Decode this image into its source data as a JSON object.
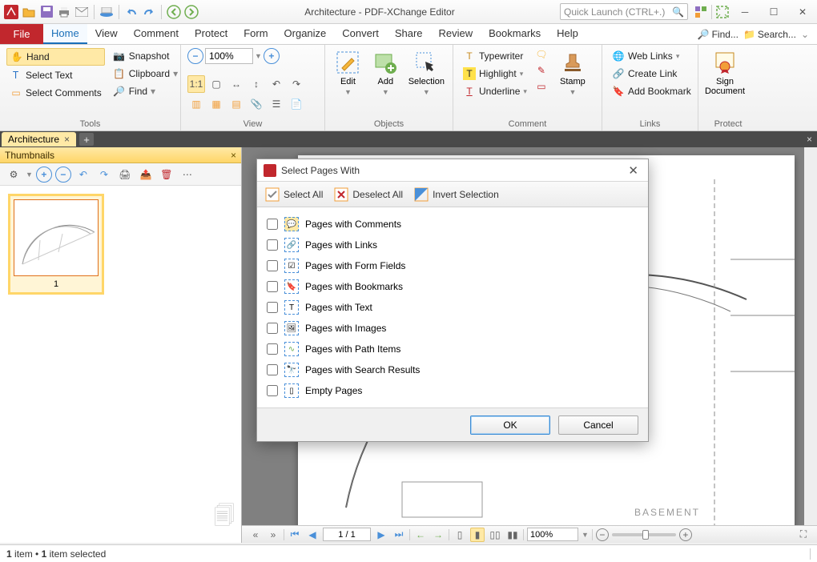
{
  "app": {
    "title": "Architecture - PDF-XChange Editor",
    "quick_launch_placeholder": "Quick Launch (CTRL+.)"
  },
  "menu": {
    "file": "File",
    "tabs": [
      "Home",
      "View",
      "Comment",
      "Protect",
      "Form",
      "Organize",
      "Convert",
      "Share",
      "Review",
      "Bookmarks",
      "Help"
    ],
    "active": "Home",
    "find": "Find...",
    "search": "Search..."
  },
  "ribbon": {
    "tools": {
      "hand": "Hand",
      "select_text": "Select Text",
      "select_comments": "Select Comments",
      "snapshot": "Snapshot",
      "clipboard": "Clipboard",
      "find": "Find",
      "label": "Tools"
    },
    "view": {
      "zoom_value": "100%",
      "label": "View"
    },
    "objects": {
      "edit": "Edit",
      "add": "Add",
      "selection": "Selection",
      "label": "Objects"
    },
    "comment": {
      "typewriter": "Typewriter",
      "highlight": "Highlight",
      "underline": "Underline",
      "stamp": "Stamp",
      "label": "Comment"
    },
    "links": {
      "weblinks": "Web Links",
      "createlink": "Create Link",
      "addbookmark": "Add Bookmark",
      "label": "Links"
    },
    "protect": {
      "sign": "Sign\nDocument",
      "label": "Protect"
    }
  },
  "doctab": {
    "name": "Architecture"
  },
  "thumbnails": {
    "title": "Thumbnails",
    "page_number": "1"
  },
  "dialog": {
    "title": "Select Pages With",
    "select_all": "Select All",
    "deselect_all": "Deselect All",
    "invert": "Invert Selection",
    "items": [
      "Pages with Comments",
      "Pages with Links",
      "Pages with Form Fields",
      "Pages with Bookmarks",
      "Pages with Text",
      "Pages with Images",
      "Pages with Path Items",
      "Pages with Search Results",
      "Empty Pages"
    ],
    "ok": "OK",
    "cancel": "Cancel"
  },
  "bottom": {
    "page": "1 / 1",
    "zoom": "100%"
  },
  "status": {
    "text": "1 item • 1 item selected"
  }
}
